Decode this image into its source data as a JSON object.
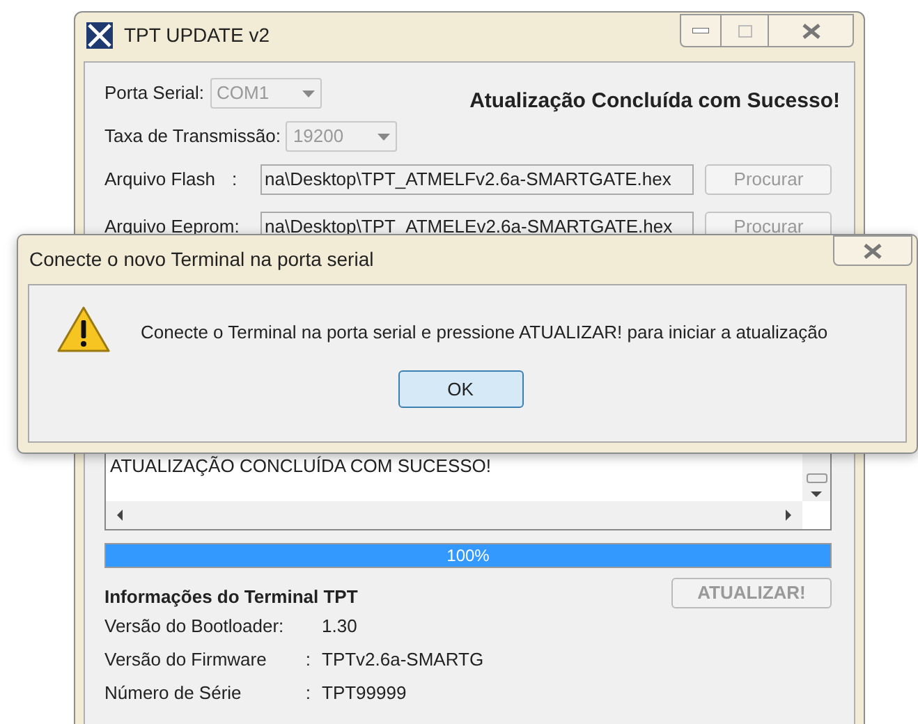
{
  "main_window": {
    "title": "TPT UPDATE v2",
    "status_message": "Atualização Concluída com Sucesso!",
    "fields": [
      {
        "kind": "dropdown",
        "label": "Porta Serial:",
        "value": "COM1",
        "disabled": true
      },
      {
        "kind": "dropdown",
        "label": "Taxa de Transmissão:",
        "value": "19200",
        "disabled": true
      },
      {
        "kind": "file",
        "label": "Arquivo Flash",
        "sep": ":",
        "value": "na\\Desktop\\TPT_ATMELFv2.6a-SMARTGATE.hex",
        "button": "Procurar",
        "disabled": true
      },
      {
        "kind": "file",
        "label": "Arquivo Eeprom:",
        "value": "na\\Desktop\\TPT_ATMELEv2.6a-SMARTGATE.hex",
        "button": "Procurar",
        "disabled": true
      }
    ],
    "log": [
      "ATUALIZAÇÃO CONCLUÍDA COM SUCESSO!"
    ],
    "progress": {
      "level": 1,
      "reading": "100%"
    },
    "info": {
      "heading": "Informações do Terminal TPT",
      "rows": [
        {
          "label": "Versão do Bootloader:",
          "value": "1.30"
        },
        {
          "label": "Versão do Firmware",
          "sep": ":",
          "value": "TPTv2.6a-SMARTG"
        },
        {
          "label": "Número de Série",
          "sep": ":",
          "value": "TPT99999"
        }
      ]
    },
    "update_button": {
      "label": "ATUALIZAR!",
      "disabled": true
    }
  },
  "dialog": {
    "title": "Conecte o novo Terminal na porta serial",
    "message": "Conecte o Terminal na porta serial e pressione ATUALIZAR! para iniciar a atualização",
    "button": "OK"
  }
}
